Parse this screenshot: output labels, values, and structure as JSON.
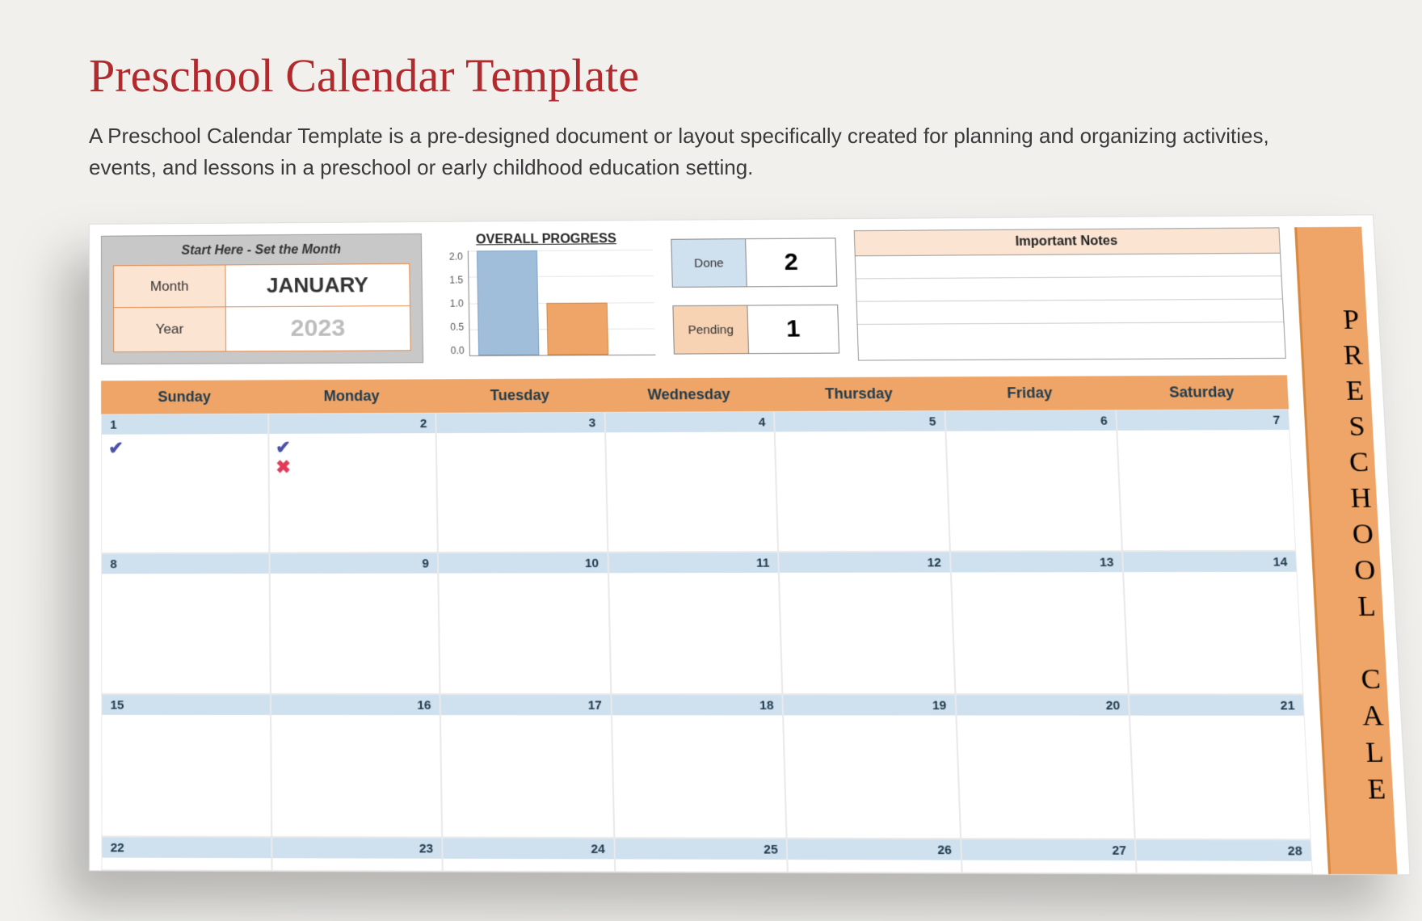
{
  "header": {
    "title": "Preschool Calendar Template",
    "description": "A Preschool Calendar Template is a pre-designed document or layout specifically created for planning and organizing activities, events, and lessons in a preschool or early childhood education setting."
  },
  "month_selector": {
    "hint": "Start Here - Set the Month",
    "month_label": "Month",
    "month_value": "JANUARY",
    "year_label": "Year",
    "year_value": "2023"
  },
  "chart_data": {
    "type": "bar",
    "title": "OVERALL PROGRESS",
    "ylim": [
      0,
      2
    ],
    "ticks": [
      "2.0",
      "1.5",
      "1.0",
      "0.5",
      "0.0"
    ],
    "series": [
      {
        "name": "Done",
        "value": 2,
        "color": "#a0bdd9"
      },
      {
        "name": "Pending",
        "value": 1,
        "color": "#efa567"
      }
    ]
  },
  "stats": {
    "done_label": "Done",
    "done_value": "2",
    "pending_label": "Pending",
    "pending_value": "1"
  },
  "notes": {
    "heading": "Important Notes",
    "lines": [
      "",
      "",
      "",
      ""
    ]
  },
  "calendar": {
    "day_headers": [
      "Sunday",
      "Monday",
      "Tuesday",
      "Wednesday",
      "Thursday",
      "Friday",
      "Saturday"
    ],
    "weeks": [
      {
        "days": [
          {
            "n": "1",
            "marks": [
              "check"
            ]
          },
          {
            "n": "2",
            "marks": [
              "check",
              "cross"
            ]
          },
          {
            "n": "3",
            "marks": []
          },
          {
            "n": "4",
            "marks": []
          },
          {
            "n": "5",
            "marks": []
          },
          {
            "n": "6",
            "marks": []
          },
          {
            "n": "7",
            "marks": []
          }
        ]
      },
      {
        "days": [
          {
            "n": "8",
            "marks": []
          },
          {
            "n": "9",
            "marks": []
          },
          {
            "n": "10",
            "marks": []
          },
          {
            "n": "11",
            "marks": []
          },
          {
            "n": "12",
            "marks": []
          },
          {
            "n": "13",
            "marks": []
          },
          {
            "n": "14",
            "marks": []
          }
        ]
      },
      {
        "days": [
          {
            "n": "15",
            "marks": []
          },
          {
            "n": "16",
            "marks": []
          },
          {
            "n": "17",
            "marks": []
          },
          {
            "n": "18",
            "marks": []
          },
          {
            "n": "19",
            "marks": []
          },
          {
            "n": "20",
            "marks": []
          },
          {
            "n": "21",
            "marks": []
          }
        ]
      },
      {
        "short": true,
        "days": [
          {
            "n": "22",
            "marks": []
          },
          {
            "n": "23",
            "marks": []
          },
          {
            "n": "24",
            "marks": []
          },
          {
            "n": "25",
            "marks": []
          },
          {
            "n": "26",
            "marks": []
          },
          {
            "n": "27",
            "marks": []
          },
          {
            "n": "28",
            "marks": []
          }
        ]
      }
    ]
  },
  "side_banner": "PRESCHOOL CALE"
}
